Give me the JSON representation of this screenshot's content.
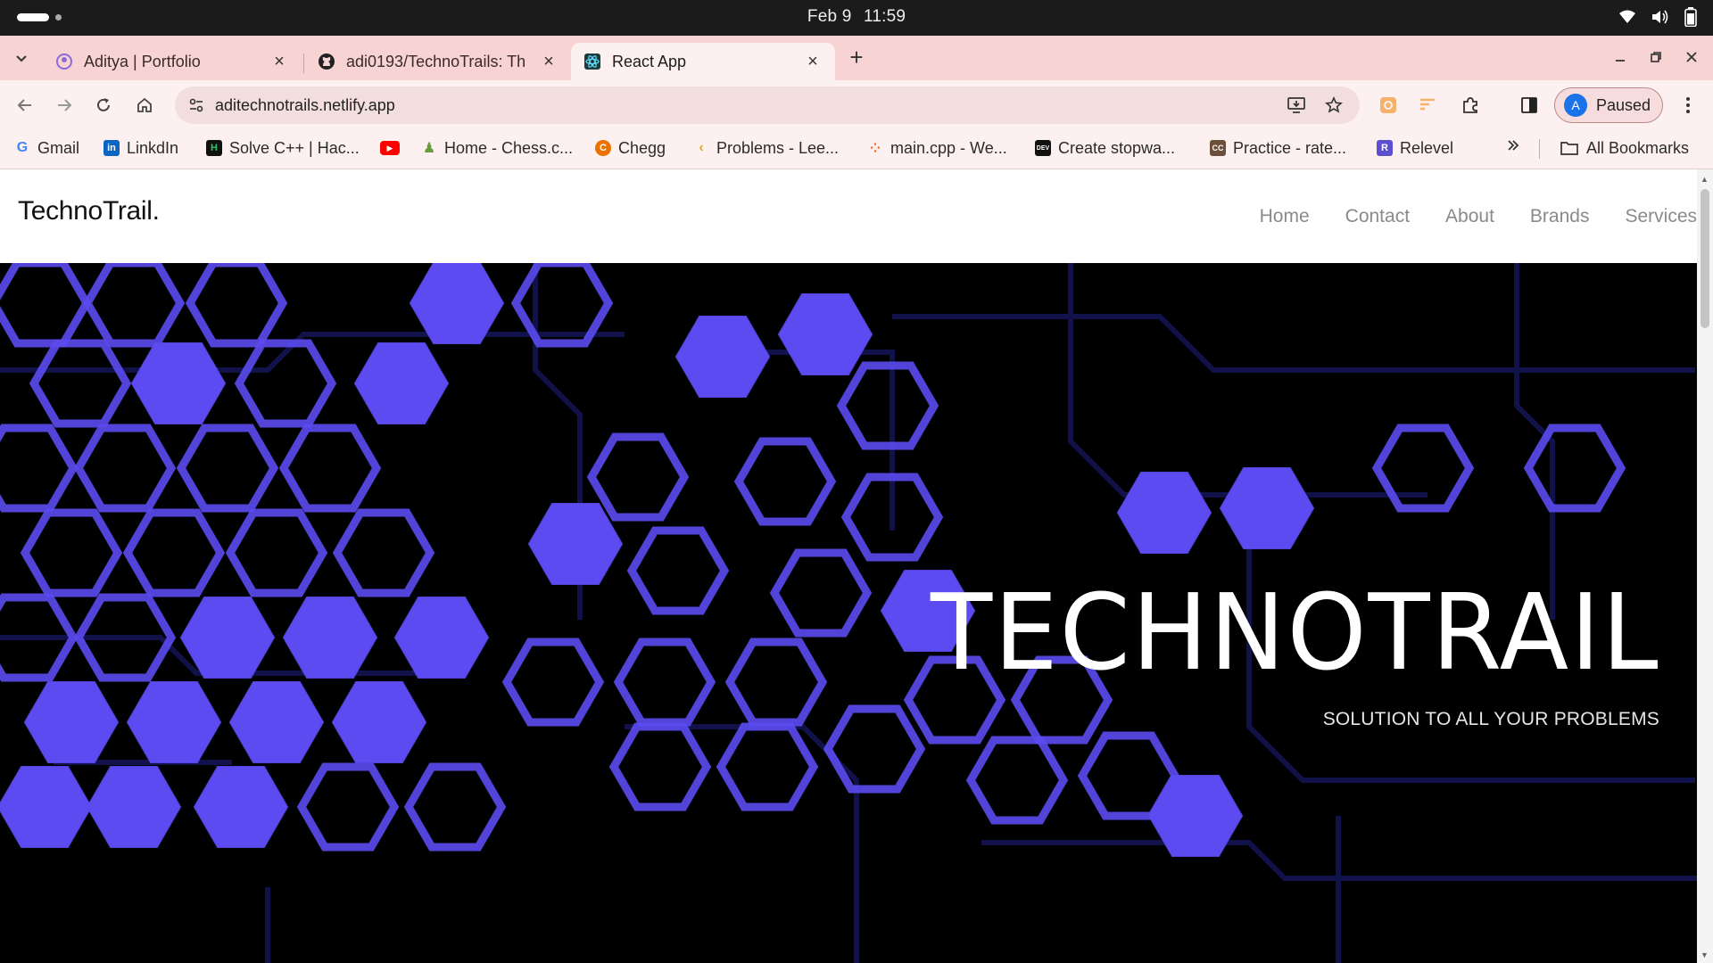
{
  "os": {
    "date": "Feb 9",
    "time": "11:59"
  },
  "tabs": [
    {
      "title": "Aditya | Portfolio",
      "active": false
    },
    {
      "title": "adi0193/TechnoTrails: Th",
      "active": false
    },
    {
      "title": "React App",
      "active": true
    }
  ],
  "toolbar": {
    "url": "aditechnotrails.netlify.app",
    "profile_initial": "A",
    "profile_label": "Paused"
  },
  "bookmarks": [
    {
      "label": "Gmail",
      "icon": "gmail-icon"
    },
    {
      "label": "LinkdIn",
      "icon": "linkedin-icon"
    },
    {
      "label": "Solve C++ | Hac...",
      "icon": "hackerrank-icon"
    },
    {
      "label": "",
      "icon": "youtube-icon"
    },
    {
      "label": "Home - Chess.c...",
      "icon": "chess-icon"
    },
    {
      "label": "Chegg",
      "icon": "chegg-icon"
    },
    {
      "label": "Problems - Lee...",
      "icon": "leetcode-icon"
    },
    {
      "label": "main.cpp - We...",
      "icon": "replit-icon"
    },
    {
      "label": "Create stopwa...",
      "icon": "dev-icon"
    },
    {
      "label": "Practice - rate...",
      "icon": "codechef-icon"
    },
    {
      "label": "Relevel",
      "icon": "relevel-icon"
    }
  ],
  "all_bookmarks_label": "All Bookmarks",
  "site": {
    "brand": "TechnoTrail.",
    "nav": [
      "Home",
      "Contact",
      "About",
      "Brands",
      "Services"
    ],
    "hero_title": "TECHNOTRAIL",
    "hero_subtitle": "SOLUTION TO ALL YOUR PROBLEMS"
  },
  "colors": {
    "tab_strip": "#f8d3d3",
    "toolbar": "#fdf0f0",
    "hex_accent": "#5b4bf0",
    "hero_bg": "#000000"
  }
}
